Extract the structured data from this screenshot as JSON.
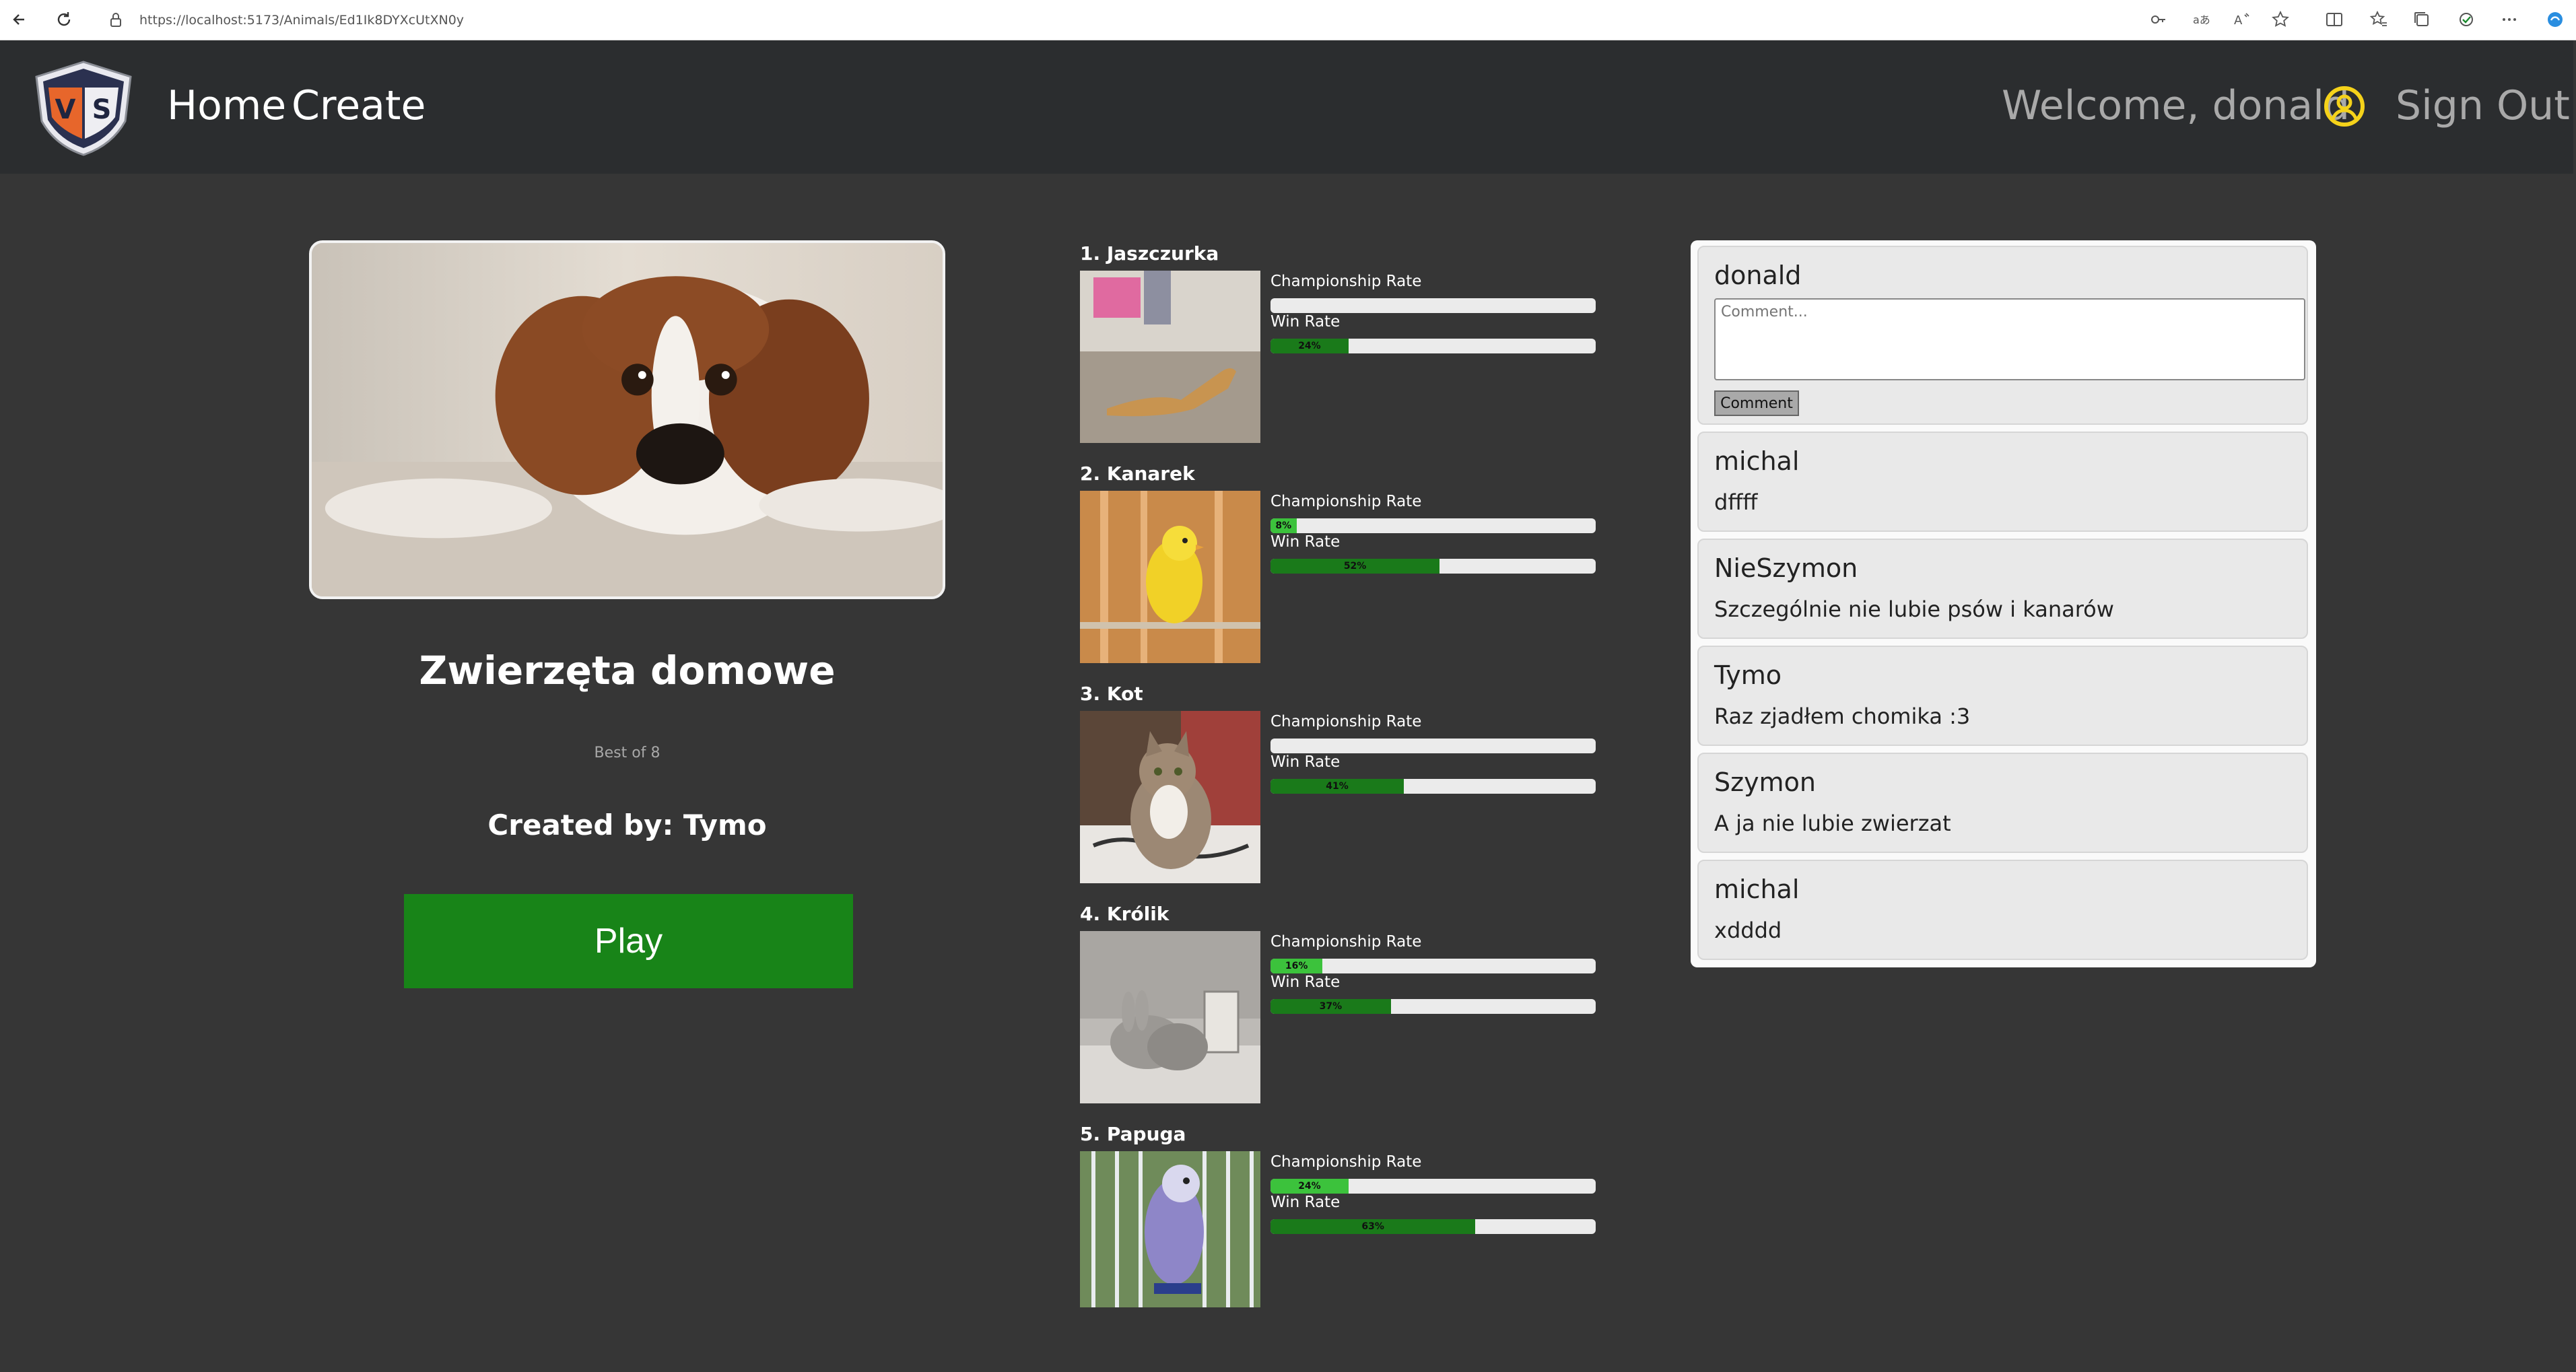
{
  "browser": {
    "url": "https://localhost:5173/Animals/Ed1Ik8DYXcUtXN0y"
  },
  "header": {
    "home_label": "Home",
    "create_label": "Create",
    "welcome_text": "Welcome, donald",
    "signout_label": "Sign Out",
    "logo_letters": "VS",
    "accent_color": "#f5d21a"
  },
  "quiz": {
    "title": "Zwierzęta domowe",
    "subtitle": "Best of 8",
    "created_by": "Created by: Tymo",
    "play_label": "Play",
    "play_color": "#188418"
  },
  "ranking": {
    "championship_label": "Championship Rate",
    "win_label": "Win Rate",
    "items": [
      {
        "title": "1. Jaszczurka",
        "championship_rate": 0,
        "championship_text": "",
        "win_rate": 24,
        "win_text": "24%"
      },
      {
        "title": "2. Kanarek",
        "championship_rate": 8,
        "championship_text": "8%",
        "win_rate": 52,
        "win_text": "52%"
      },
      {
        "title": "3. Kot",
        "championship_rate": 0,
        "championship_text": "",
        "win_rate": 41,
        "win_text": "41%"
      },
      {
        "title": "4. Królik",
        "championship_rate": 16,
        "championship_text": "16%",
        "win_rate": 37,
        "win_text": "37%"
      },
      {
        "title": "5. Papuga",
        "championship_rate": 24,
        "championship_text": "24%",
        "win_rate": 63,
        "win_text": "63%"
      }
    ]
  },
  "comments": {
    "current_user": "donald",
    "placeholder": "Comment...",
    "submit_label": "Comment",
    "items": [
      {
        "author": "michal",
        "text": "dffff"
      },
      {
        "author": "NieSzymon",
        "text": "Szczególnie nie lubie psów i kanarów"
      },
      {
        "author": "Tymo",
        "text": "Raz zjadłem chomika :3"
      },
      {
        "author": "Szymon",
        "text": "A ja nie lubie zwierzat"
      },
      {
        "author": "michal",
        "text": "xdddd"
      }
    ]
  }
}
